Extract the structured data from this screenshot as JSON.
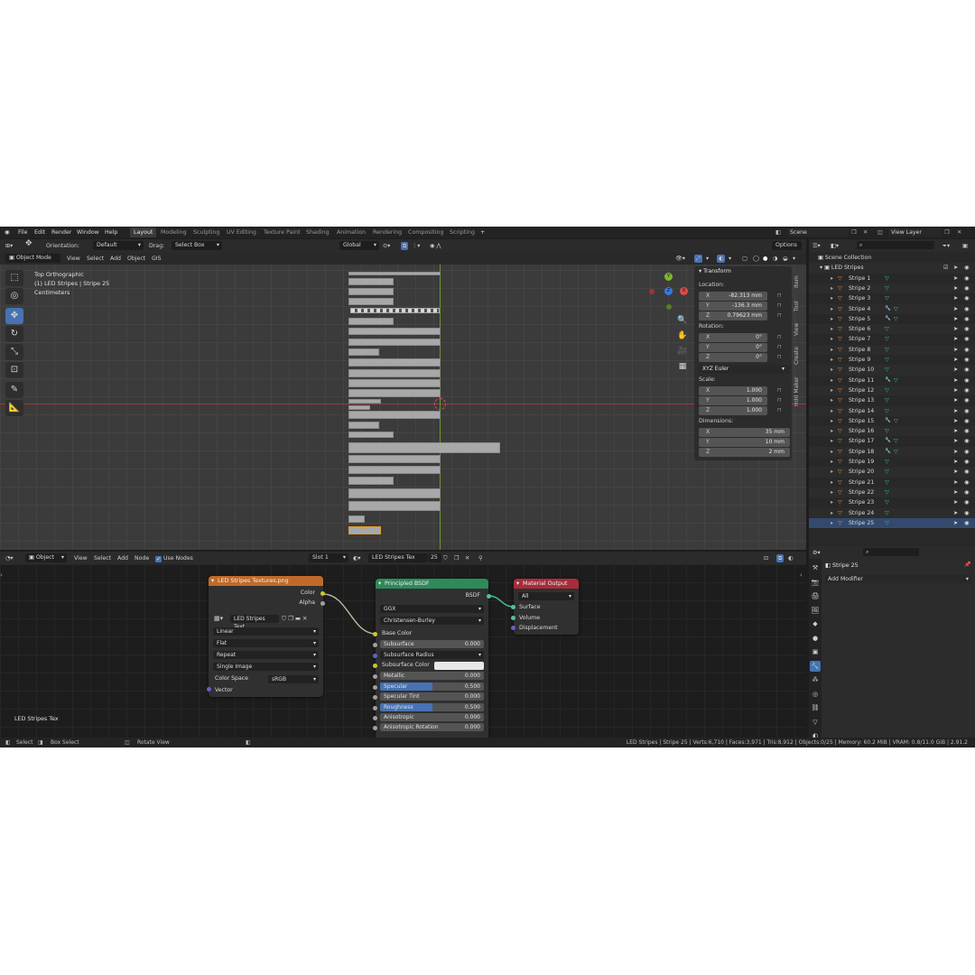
{
  "topbar": {
    "menus": [
      "File",
      "Edit",
      "Render",
      "Window",
      "Help"
    ],
    "workspaces": [
      "Layout",
      "Modeling",
      "Sculpting",
      "UV Editing",
      "Texture Paint",
      "Shading",
      "Animation",
      "Rendering",
      "Compositing",
      "Scripting"
    ],
    "active_workspace": "Layout",
    "add_tab": "+",
    "scene_field": "Scene",
    "view_layer_field": "View Layer"
  },
  "viewport_header": {
    "orientation_label": "Orientation:",
    "orientation_value": "Default",
    "drag_label": "Drag:",
    "drag_value": "Select Box",
    "transform_space": "Global",
    "options": "Options",
    "mode": "Object Mode",
    "menus": [
      "View",
      "Select",
      "Add",
      "Object",
      "GIS"
    ]
  },
  "viewport": {
    "view_name": "Top Orthographic",
    "object_info": "(1) LED Stripes | Stripe 25",
    "units": "Centimeters"
  },
  "npanel": {
    "section": "Transform",
    "location_label": "Location:",
    "location": [
      {
        "axis": "X",
        "value": "-82.313 mm"
      },
      {
        "axis": "Y",
        "value": "-136.3 mm"
      },
      {
        "axis": "Z",
        "value": "0.79623 mm"
      }
    ],
    "rotation_label": "Rotation:",
    "rotation": [
      {
        "axis": "X",
        "value": "0°"
      },
      {
        "axis": "Y",
        "value": "0°"
      },
      {
        "axis": "Z",
        "value": "0°"
      }
    ],
    "rotation_mode": "XYZ Euler",
    "scale_label": "Scale:",
    "scale": [
      {
        "axis": "X",
        "value": "1.000"
      },
      {
        "axis": "Y",
        "value": "1.000"
      },
      {
        "axis": "Z",
        "value": "1.000"
      }
    ],
    "dimensions_label": "Dimensions:",
    "dimensions": [
      {
        "axis": "X",
        "value": "35 mm"
      },
      {
        "axis": "Y",
        "value": "10 mm"
      },
      {
        "axis": "Z",
        "value": "2 mm"
      }
    ],
    "tabs": [
      "Item",
      "Tool",
      "View",
      "Create",
      "Hdri Maker"
    ]
  },
  "outliner": {
    "root": "Scene Collection",
    "collection": "LED Stripes",
    "items": [
      "Stripe 1",
      "Stripe 2",
      "Stripe 3",
      "Stripe 4",
      "Stripe 5",
      "Stripe 6",
      "Stripe 7",
      "Stripe 8",
      "Stripe 9",
      "Stripe 10",
      "Stripe 11",
      "Stripe 12",
      "Stripe 13",
      "Stripe 14",
      "Stripe 15",
      "Stripe 16",
      "Stripe 17",
      "Stripe 18",
      "Stripe 19",
      "Stripe 20",
      "Stripe 21",
      "Stripe 22",
      "Stripe 23",
      "Stripe 24",
      "Stripe 25"
    ]
  },
  "properties": {
    "object_name": "Stripe 25",
    "add_modifier": "Add Modifier"
  },
  "node_header": {
    "editor_type": "Object",
    "menus": [
      "View",
      "Select",
      "Add",
      "Node"
    ],
    "use_nodes": "Use Nodes",
    "slot": "Slot 1",
    "material": "LED Stripes Tex",
    "users": "25"
  },
  "nodes": {
    "image": {
      "title": "LED Stripes Textures.png",
      "out_color": "Color",
      "out_alpha": "Alpha",
      "image_name": "LED Stripes Text...",
      "interpolation": "Linear",
      "projection": "Flat",
      "extension": "Repeat",
      "source": "Single Image",
      "color_space_label": "Color Space",
      "color_space": "sRGB",
      "in_vector": "Vector"
    },
    "bsdf": {
      "title": "Principled BSDF",
      "out": "BSDF",
      "distribution": "GGX",
      "subsurface_method": "Christensen-Burley",
      "base_color": "Base Color",
      "subsurface": "Subsurface",
      "subsurface_value": "0.000",
      "subsurface_radius": "Subsurface Radius",
      "subsurface_color": "Subsurface Color",
      "metallic": "Metallic",
      "metallic_value": "0.000",
      "specular": "Specular",
      "specular_value": "0.500",
      "specular_fill": 0.5,
      "specular_tint": "Specular Tint",
      "specular_tint_value": "0.000",
      "roughness": "Roughness",
      "roughness_value": "0.500",
      "roughness_fill": 0.5,
      "anisotropic": "Anisotropic",
      "anisotropic_value": "0.000",
      "anisotropic_rotation": "Anisotropic Rotation",
      "anisotropic_rotation_value": "0.000"
    },
    "output": {
      "title": "Material Output",
      "target": "All",
      "surface": "Surface",
      "volume": "Volume",
      "displacement": "Displacement"
    }
  },
  "node_editor_label": "LED Stripes Tex",
  "statusbar": {
    "select": "Select",
    "box_select": "Box Select",
    "rotate_view": "Rotate View",
    "info": "LED Stripes | Stripe 25 | Verts:6,710 | Faces:3,971 | Tris:8,912 | Objects:0/25 | Memory: 60.2 MiB | VRAM: 0.8/11.0 GiB | 2.91.2"
  },
  "colors": {
    "accent": "#4772b3",
    "image_node_header": "#c06a2a",
    "bsdf_node_header": "#2e8a5a",
    "output_node_header": "#a82c39",
    "mesh_icon": "#33c08a",
    "outliner_object_icon": "#e0893b"
  }
}
